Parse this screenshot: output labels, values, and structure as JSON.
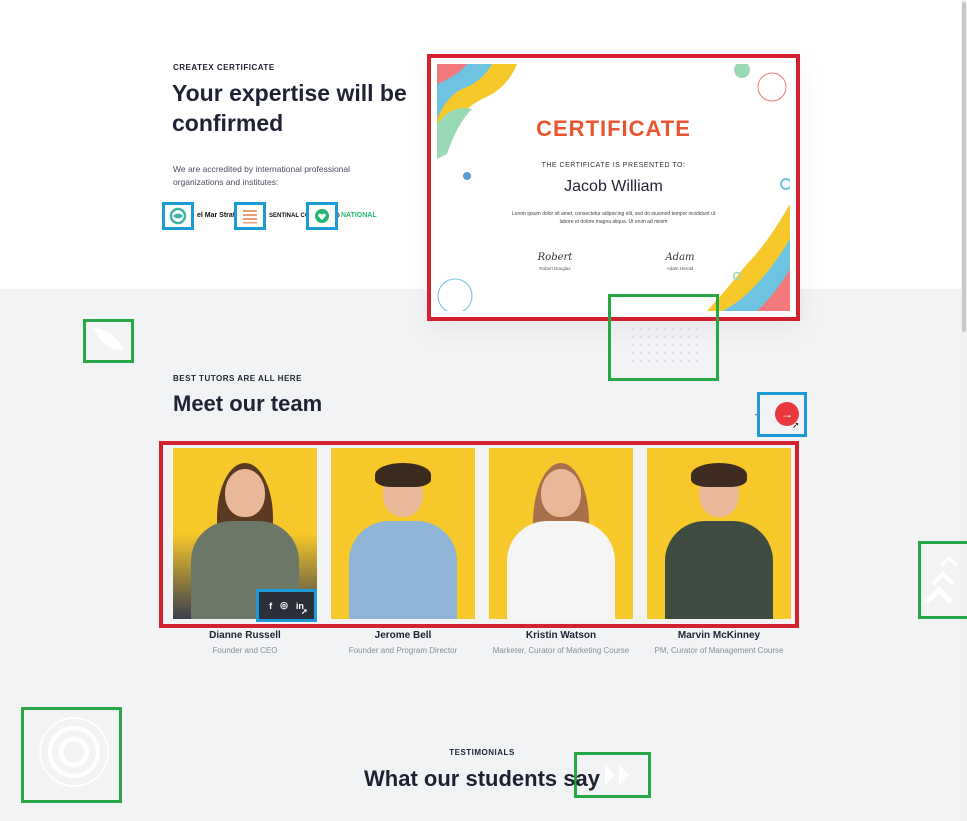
{
  "certificate_section": {
    "eyebrow": "CREATEX CERTIFICATE",
    "title": "Your expertise will be confirmed",
    "description": "We are accredited by international professional organizations and institutes:",
    "partners": [
      {
        "name": "el Mar Strategy",
        "icon": "swirl-logo-icon"
      },
      {
        "name": "SENTINAL CONSULTING",
        "icon": "stripes-logo-icon"
      },
      {
        "name": "NATIONAL",
        "icon": "heart-logo-icon"
      }
    ],
    "certificate": {
      "heading": "CERTIFICATE",
      "presented": "THE CERTIFICATE IS PRESENTED TO:",
      "recipient": "Jacob William",
      "body": "Lorem ipsum dolor sit amet, consectetur adipiscing elit, sed do eiusmod tempor incididunt ut labore et dolore magna aliqua. Ut enim ad minim",
      "signatures": [
        {
          "script": "Robert",
          "name": "Robert Douglas"
        },
        {
          "script": "Adam",
          "name": "Adam Harold"
        }
      ]
    }
  },
  "team_section": {
    "eyebrow": "BEST TUTORS ARE ALL HERE",
    "title": "Meet our team",
    "nav": {
      "prev": "←",
      "next": "→"
    },
    "members": [
      {
        "name": "Dianne Russell",
        "role": "Founder and CEO"
      },
      {
        "name": "Jerome Bell",
        "role": "Founder and Program Director"
      },
      {
        "name": "Kristin Watson",
        "role": "Marketer, Curator of Marketing Course"
      },
      {
        "name": "Marvin McKinney",
        "role": "PM, Curator of Management Course"
      }
    ],
    "social": {
      "facebook": "f",
      "instagram": "◎",
      "linkedin": "in"
    }
  },
  "testimonials_section": {
    "eyebrow": "TESTIMONIALS",
    "title": "What our students say"
  },
  "colors": {
    "accent_red": "#e8383d",
    "cert_orange": "#e85530",
    "member_bg": "#f7c829",
    "grey_bg": "#f2f3f5"
  }
}
